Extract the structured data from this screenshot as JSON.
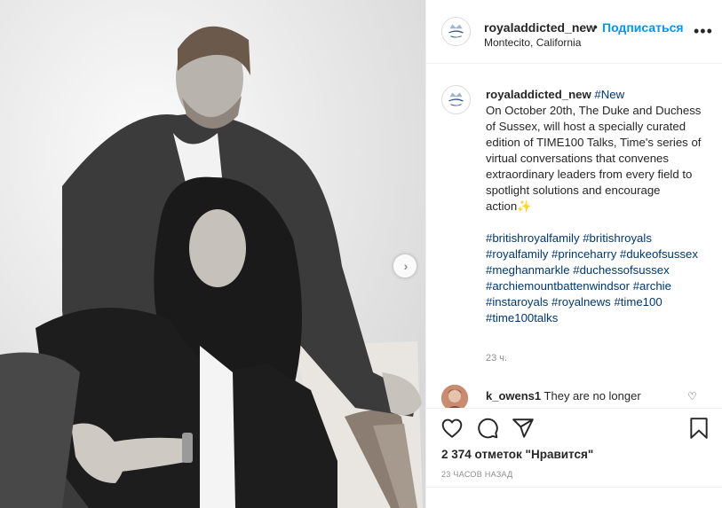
{
  "post": {
    "username": "royaladdicted_new",
    "follow_label": "Подписаться",
    "dot": "•",
    "location": "Montecito, California",
    "more_icon": "ellipsis-icon",
    "caption": {
      "username": "royaladdicted_new",
      "hashtag_first": "#New",
      "body": "On October 20th, The Duke and Duchess of Sussex, will host a specially curated edition of TIME100 Talks, Time's series of virtual conversations that convenes extraordinary leaders from every field to spotlight solutions and encourage action",
      "emoji": "✨",
      "hashtags": [
        "#britishroyalfamily",
        "#britishroyals",
        "#royalfamily",
        "#princeharry",
        "#dukeofsussex",
        "#meghanmarkle",
        "#duchessofsussex",
        "#archiemountbattenwindsor",
        "#archie",
        "#instaroyals",
        "#royalnews",
        "#time100",
        "#time100talks"
      ],
      "time": "23 ч."
    },
    "comment": {
      "username": "k_owens1",
      "text": "They are no longer"
    },
    "likes": "2 374 отметок \"Нравится\"",
    "posted_ago": "23 ЧАСОВ НАЗАД"
  },
  "colors": {
    "link": "#0095f6",
    "hashtag": "#00376b",
    "muted": "#8e8e8e",
    "text": "#262626",
    "border": "#efefef"
  },
  "icons": [
    "heart-icon",
    "comment-icon",
    "share-icon",
    "bookmark-icon",
    "chevron-right-icon"
  ]
}
